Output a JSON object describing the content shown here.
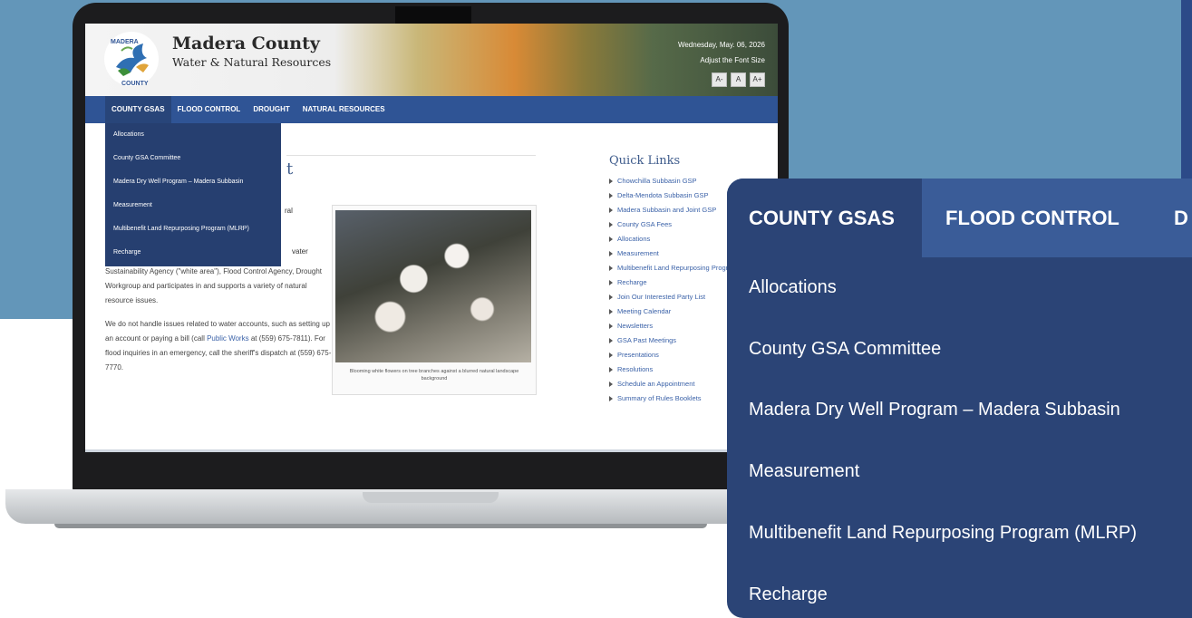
{
  "site": {
    "name": "Madera County",
    "subtitle": "Water & Natural Resources",
    "logo_text": "MADERA COUNTY",
    "date": "Wednesday, May. 06, 2026",
    "adjust_font_label": "Adjust the Font Size",
    "font_buttons": [
      "A-",
      "A",
      "A+"
    ]
  },
  "nav": {
    "items": [
      "COUNTY GSAS",
      "FLOOD CONTROL",
      "DROUGHT",
      "NATURAL RESOURCES"
    ],
    "active": "COUNTY GSAS"
  },
  "dropdown": {
    "items": [
      "Allocations",
      "County GSA Committee",
      "Madera Dry Well Program – Madera Subbasin",
      "Measurement",
      "Multibenefit Land Repurposing Program (MLRP)",
      "Recharge"
    ]
  },
  "content": {
    "title_fragment": "t",
    "frag1": "ral",
    "frag2": "vater",
    "para1": "Sustainability Agency (\"white area\"), Flood Control Agency, Drought Workgroup and participates in and supports a variety of natural resource issues.",
    "para2_start": "We do not handle issues related to water accounts, such as setting up an account or paying a bill (call ",
    "para2_link": "Public Works",
    "para2_end": " at (559) 675-7811). For flood inquiries in an emergency, call the sheriff's dispatch at (559) 675-7770.",
    "photo_caption": "Blooming white flowers on tree branches against a blurred natural landscape background"
  },
  "quick_links": {
    "title": "Quick Links",
    "items": [
      "Chowchilla Subbasin GSP",
      "Delta-Mendota Subbasin GSP",
      "Madera Subbasin and Joint GSP",
      "County GSA Fees",
      "Allocations",
      "Measurement",
      "Multibenefit Land Repurposing Program (MLRP)",
      "Recharge",
      "Join Our Interested Party List",
      "Meeting Calendar",
      "Newsletters",
      "GSA Past Meetings",
      "Presentations",
      "Resolutions",
      "Schedule an Appointment",
      "Summary of Rules Booklets"
    ]
  },
  "zoom": {
    "tabs": [
      "COUNTY GSAS",
      "FLOOD CONTROL",
      "D"
    ],
    "items": [
      "Allocations",
      "County GSA Committee",
      "Madera Dry Well Program – Madera Subbasin",
      "Measurement",
      "Multibenefit Land Repurposing Program (MLRP)",
      "Recharge"
    ]
  },
  "colors": {
    "background": "#6396b9",
    "nav": "#2f5495",
    "dropdown": "#263f70",
    "zoom_panel": "#2b4476",
    "link": "#3b62a8"
  }
}
